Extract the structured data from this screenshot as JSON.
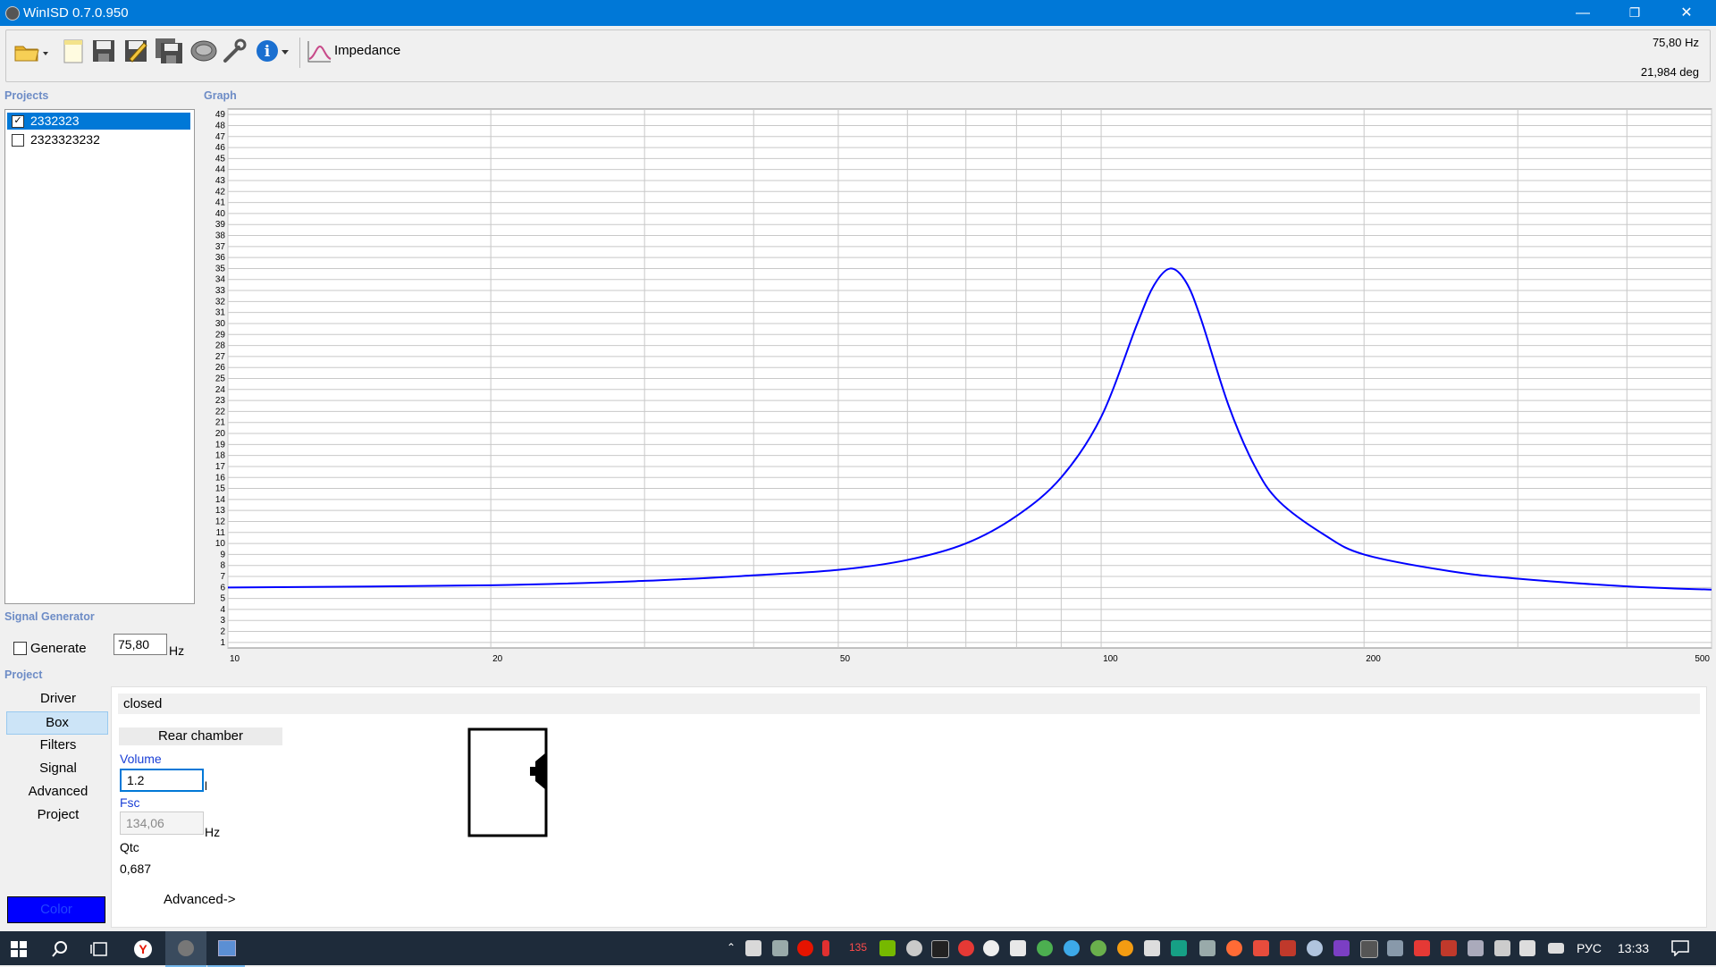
{
  "app": {
    "title": "WinISD 0.7.0.950"
  },
  "window_controls": {
    "minimize": "—",
    "restore": "❐",
    "close": "✕"
  },
  "toolbar": {
    "icons": [
      "open-folder-icon",
      "new-project-icon",
      "save-icon",
      "save-as-icon",
      "save-all-icon",
      "driver-icon",
      "wrench-icon",
      "info-icon",
      "impedance-graph-icon"
    ],
    "graph_select_label": "Impedance",
    "readout_freq": "75,80 Hz",
    "readout_phase": "21,984 deg"
  },
  "projects": {
    "heading": "Projects",
    "items": [
      {
        "label": "2332323",
        "checked": true,
        "selected": true
      },
      {
        "label": "2323323232",
        "checked": false,
        "selected": false
      }
    ]
  },
  "signal_generator": {
    "heading": "Signal Generator",
    "generate_label": "Generate",
    "frequency_value": "75,80",
    "unit": "Hz"
  },
  "graph": {
    "heading": "Graph"
  },
  "chart_data": {
    "type": "line",
    "title": "",
    "xlabel": "",
    "ylabel": "",
    "x_scale": "log",
    "xlim": [
      10,
      500
    ],
    "ylim": [
      1,
      49
    ],
    "x_ticks": [
      10,
      20,
      50,
      100,
      200,
      500
    ],
    "y_ticks": [
      1,
      2,
      3,
      4,
      5,
      6,
      7,
      8,
      9,
      10,
      11,
      12,
      13,
      14,
      15,
      16,
      17,
      18,
      19,
      20,
      21,
      22,
      23,
      24,
      25,
      26,
      27,
      28,
      29,
      30,
      31,
      32,
      33,
      34,
      35,
      36,
      37,
      38,
      39,
      40,
      41,
      42,
      43,
      44,
      45,
      46,
      47,
      48,
      49
    ],
    "grid": true,
    "series": [
      {
        "name": "",
        "color": "#0000ff",
        "x": [
          10,
          20,
          30,
          40,
          50,
          60,
          70,
          80,
          90,
          100,
          110,
          115,
          120,
          125,
          130,
          140,
          150,
          160,
          180,
          200,
          250,
          300,
          400,
          500
        ],
        "y": [
          6.0,
          6.2,
          6.6,
          7.1,
          7.6,
          8.5,
          10.0,
          12.5,
          16.0,
          21.5,
          30.0,
          33.5,
          35.0,
          33.8,
          30.5,
          22.5,
          17.0,
          13.8,
          10.8,
          9.0,
          7.5,
          6.8,
          6.1,
          5.8
        ]
      }
    ]
  },
  "project_section": {
    "heading": "Project",
    "nav": [
      "Driver",
      "Box",
      "Filters",
      "Signal",
      "Advanced",
      "Project"
    ],
    "active_nav": "Box",
    "color_button": "Color",
    "color_value": "#0000ff"
  },
  "box": {
    "type_value": "closed",
    "rear_chamber_label": "Rear chamber",
    "volume_label": "Volume",
    "volume_value": "1.2",
    "volume_unit": "l",
    "fsc_label": "Fsc",
    "fsc_value": "134,06",
    "fsc_unit": "Hz",
    "qtc_label": "Qtc",
    "qtc_value": "0,687",
    "advanced_button": "Advanced->"
  },
  "taskbar": {
    "language": "РУС",
    "time": "13:33",
    "tray_badge": "135"
  }
}
